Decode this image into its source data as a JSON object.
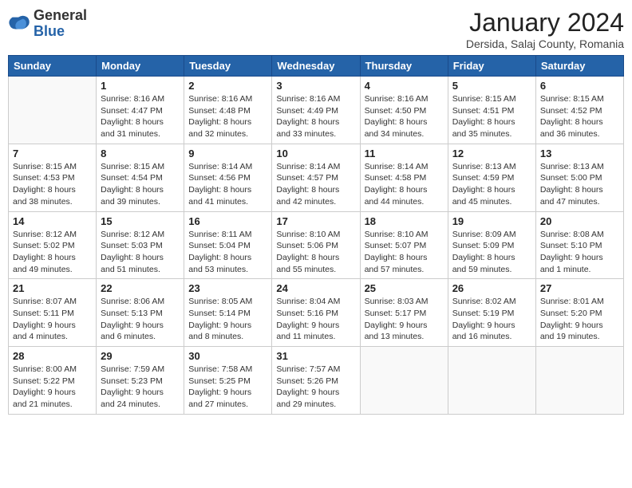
{
  "logo": {
    "general": "General",
    "blue": "Blue"
  },
  "header": {
    "month_title": "January 2024",
    "subtitle": "Dersida, Salaj County, Romania"
  },
  "days_of_week": [
    "Sunday",
    "Monday",
    "Tuesday",
    "Wednesday",
    "Thursday",
    "Friday",
    "Saturday"
  ],
  "weeks": [
    [
      {
        "day": "",
        "info": ""
      },
      {
        "day": "1",
        "info": "Sunrise: 8:16 AM\nSunset: 4:47 PM\nDaylight: 8 hours\nand 31 minutes."
      },
      {
        "day": "2",
        "info": "Sunrise: 8:16 AM\nSunset: 4:48 PM\nDaylight: 8 hours\nand 32 minutes."
      },
      {
        "day": "3",
        "info": "Sunrise: 8:16 AM\nSunset: 4:49 PM\nDaylight: 8 hours\nand 33 minutes."
      },
      {
        "day": "4",
        "info": "Sunrise: 8:16 AM\nSunset: 4:50 PM\nDaylight: 8 hours\nand 34 minutes."
      },
      {
        "day": "5",
        "info": "Sunrise: 8:15 AM\nSunset: 4:51 PM\nDaylight: 8 hours\nand 35 minutes."
      },
      {
        "day": "6",
        "info": "Sunrise: 8:15 AM\nSunset: 4:52 PM\nDaylight: 8 hours\nand 36 minutes."
      }
    ],
    [
      {
        "day": "7",
        "info": "Sunrise: 8:15 AM\nSunset: 4:53 PM\nDaylight: 8 hours\nand 38 minutes."
      },
      {
        "day": "8",
        "info": "Sunrise: 8:15 AM\nSunset: 4:54 PM\nDaylight: 8 hours\nand 39 minutes."
      },
      {
        "day": "9",
        "info": "Sunrise: 8:14 AM\nSunset: 4:56 PM\nDaylight: 8 hours\nand 41 minutes."
      },
      {
        "day": "10",
        "info": "Sunrise: 8:14 AM\nSunset: 4:57 PM\nDaylight: 8 hours\nand 42 minutes."
      },
      {
        "day": "11",
        "info": "Sunrise: 8:14 AM\nSunset: 4:58 PM\nDaylight: 8 hours\nand 44 minutes."
      },
      {
        "day": "12",
        "info": "Sunrise: 8:13 AM\nSunset: 4:59 PM\nDaylight: 8 hours\nand 45 minutes."
      },
      {
        "day": "13",
        "info": "Sunrise: 8:13 AM\nSunset: 5:00 PM\nDaylight: 8 hours\nand 47 minutes."
      }
    ],
    [
      {
        "day": "14",
        "info": "Sunrise: 8:12 AM\nSunset: 5:02 PM\nDaylight: 8 hours\nand 49 minutes."
      },
      {
        "day": "15",
        "info": "Sunrise: 8:12 AM\nSunset: 5:03 PM\nDaylight: 8 hours\nand 51 minutes."
      },
      {
        "day": "16",
        "info": "Sunrise: 8:11 AM\nSunset: 5:04 PM\nDaylight: 8 hours\nand 53 minutes."
      },
      {
        "day": "17",
        "info": "Sunrise: 8:10 AM\nSunset: 5:06 PM\nDaylight: 8 hours\nand 55 minutes."
      },
      {
        "day": "18",
        "info": "Sunrise: 8:10 AM\nSunset: 5:07 PM\nDaylight: 8 hours\nand 57 minutes."
      },
      {
        "day": "19",
        "info": "Sunrise: 8:09 AM\nSunset: 5:09 PM\nDaylight: 8 hours\nand 59 minutes."
      },
      {
        "day": "20",
        "info": "Sunrise: 8:08 AM\nSunset: 5:10 PM\nDaylight: 9 hours\nand 1 minute."
      }
    ],
    [
      {
        "day": "21",
        "info": "Sunrise: 8:07 AM\nSunset: 5:11 PM\nDaylight: 9 hours\nand 4 minutes."
      },
      {
        "day": "22",
        "info": "Sunrise: 8:06 AM\nSunset: 5:13 PM\nDaylight: 9 hours\nand 6 minutes."
      },
      {
        "day": "23",
        "info": "Sunrise: 8:05 AM\nSunset: 5:14 PM\nDaylight: 9 hours\nand 8 minutes."
      },
      {
        "day": "24",
        "info": "Sunrise: 8:04 AM\nSunset: 5:16 PM\nDaylight: 9 hours\nand 11 minutes."
      },
      {
        "day": "25",
        "info": "Sunrise: 8:03 AM\nSunset: 5:17 PM\nDaylight: 9 hours\nand 13 minutes."
      },
      {
        "day": "26",
        "info": "Sunrise: 8:02 AM\nSunset: 5:19 PM\nDaylight: 9 hours\nand 16 minutes."
      },
      {
        "day": "27",
        "info": "Sunrise: 8:01 AM\nSunset: 5:20 PM\nDaylight: 9 hours\nand 19 minutes."
      }
    ],
    [
      {
        "day": "28",
        "info": "Sunrise: 8:00 AM\nSunset: 5:22 PM\nDaylight: 9 hours\nand 21 minutes."
      },
      {
        "day": "29",
        "info": "Sunrise: 7:59 AM\nSunset: 5:23 PM\nDaylight: 9 hours\nand 24 minutes."
      },
      {
        "day": "30",
        "info": "Sunrise: 7:58 AM\nSunset: 5:25 PM\nDaylight: 9 hours\nand 27 minutes."
      },
      {
        "day": "31",
        "info": "Sunrise: 7:57 AM\nSunset: 5:26 PM\nDaylight: 9 hours\nand 29 minutes."
      },
      {
        "day": "",
        "info": ""
      },
      {
        "day": "",
        "info": ""
      },
      {
        "day": "",
        "info": ""
      }
    ]
  ]
}
